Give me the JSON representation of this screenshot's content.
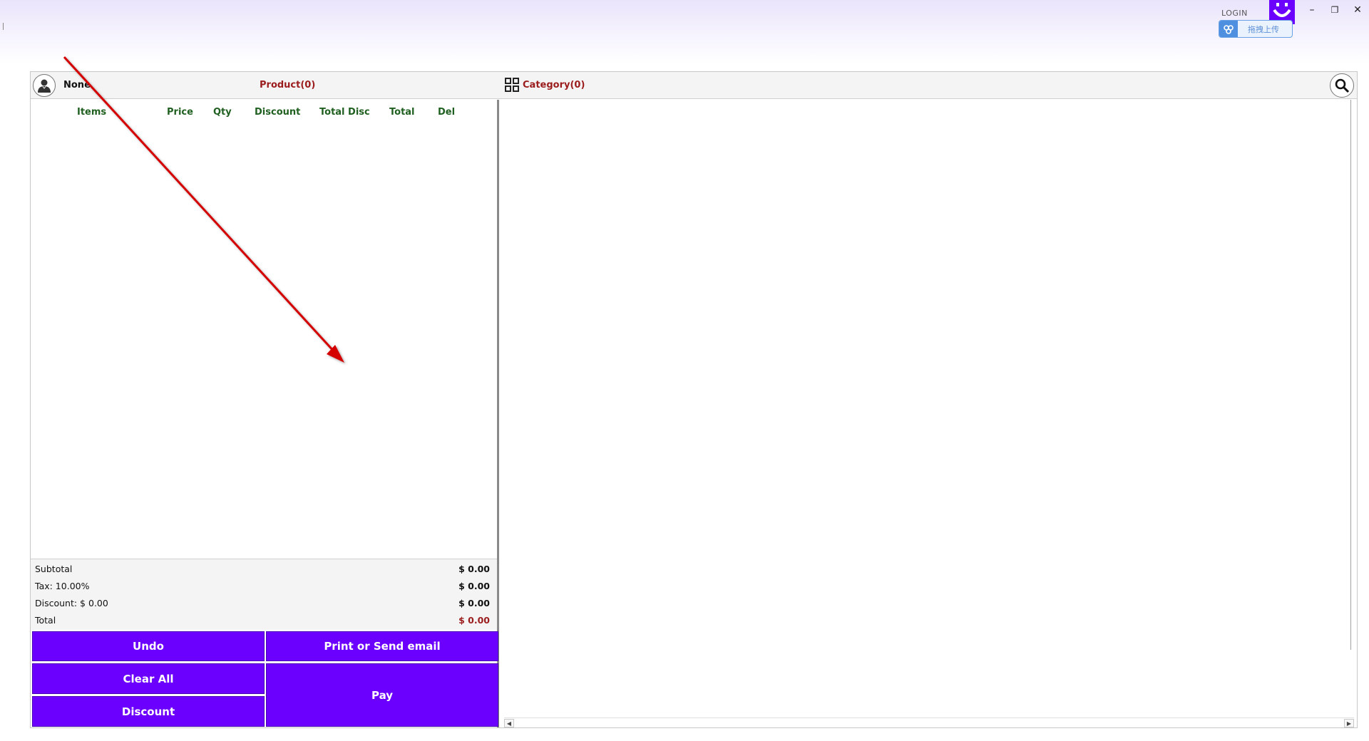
{
  "header": {
    "login_label": "LOGIN",
    "upload_label": "拖拽上传",
    "minimize": "–",
    "restore": "❐",
    "close": "✕"
  },
  "toolbar": {
    "customer_name": "None",
    "product_tab": "Product(0)",
    "category_tab": "Category(0)"
  },
  "table": {
    "columns": [
      "Items",
      "Price",
      "Qty",
      "Discount",
      "Total Disc",
      "Total",
      "Del"
    ]
  },
  "summary": {
    "subtotal_label": "Subtotal",
    "subtotal_value": "$ 0.00",
    "tax_label": "Tax: 10.00%",
    "tax_value": "$ 0.00",
    "discount_label": "Discount: $ 0.00",
    "discount_value": "$ 0.00",
    "total_label": "Total",
    "total_value": "$ 0.00"
  },
  "actions": {
    "undo": "Undo",
    "print_email": "Print or Send email",
    "clear_all": "Clear All",
    "pay": "Pay",
    "discount": "Discount"
  },
  "colors": {
    "accent": "#6b00ff",
    "label_red": "#9b1c1c",
    "header_green": "#1f5f1f",
    "annotation": "#d40000"
  }
}
